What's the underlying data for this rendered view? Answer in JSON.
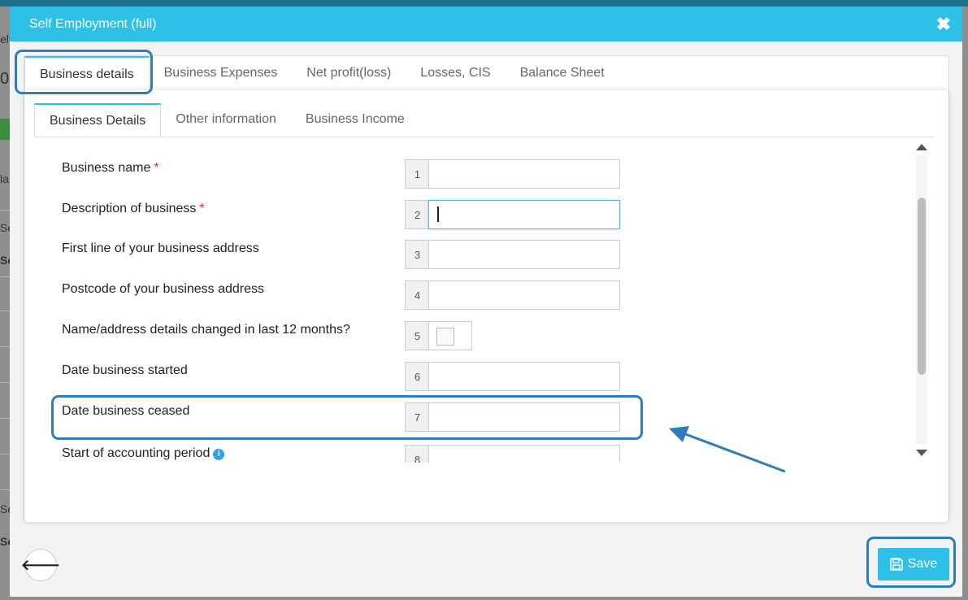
{
  "modal": {
    "title": "Self Employment (full)",
    "close_symbol": "✖"
  },
  "outer_tabs": [
    {
      "label": "Business details"
    },
    {
      "label": "Business Expenses"
    },
    {
      "label": "Net profit(loss)"
    },
    {
      "label": "Losses, CIS"
    },
    {
      "label": "Balance Sheet"
    }
  ],
  "inner_tabs": [
    {
      "label": "Business Details"
    },
    {
      "label": "Other information"
    },
    {
      "label": "Business Income"
    }
  ],
  "fields": [
    {
      "label": "Business name",
      "required": "*",
      "box": "1",
      "value": ""
    },
    {
      "label": "Description of business",
      "required": "*",
      "box": "2",
      "value": ""
    },
    {
      "label": "First line of your business address",
      "box": "3",
      "value": ""
    },
    {
      "label": "Postcode of your business address",
      "box": "4",
      "value": ""
    },
    {
      "label": "Name/address details changed in last 12 months?",
      "box": "5",
      "checked": false
    },
    {
      "label": "Date business started",
      "box": "6",
      "value": ""
    },
    {
      "label": "Date business ceased",
      "box": "7",
      "value": ""
    },
    {
      "label": "Start of accounting period",
      "box": "8",
      "value": ""
    }
  ],
  "footer": {
    "back_symbol": "🡐",
    "save_label": "Save"
  },
  "colors": {
    "header": "#2fc0e8",
    "annotation": "#2e7db8",
    "required": "#e03030"
  },
  "icons": {
    "close": "close-icon",
    "back": "arrow-left-icon",
    "save": "floppy-disk-icon",
    "info": "info-icon"
  }
}
